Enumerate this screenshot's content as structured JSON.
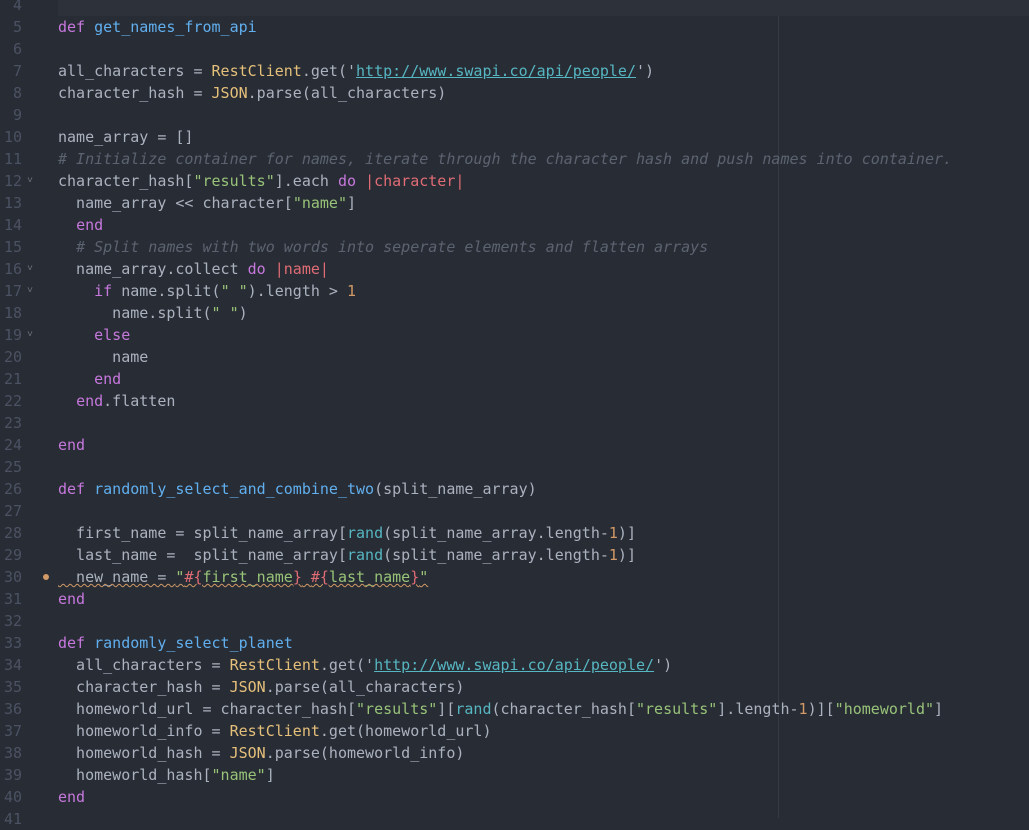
{
  "cursor_line": 4,
  "lines": [
    {
      "n": "4",
      "t": []
    },
    {
      "n": "5",
      "t": [
        [
          "k",
          "def"
        ],
        [
          "p",
          " "
        ],
        [
          "f",
          "get_names_from_api"
        ]
      ]
    },
    {
      "n": "6",
      "t": []
    },
    {
      "n": "7",
      "t": [
        [
          "p",
          "all_characters = "
        ],
        [
          "c",
          "RestClient"
        ],
        [
          "p",
          ".get('"
        ],
        [
          "u",
          "http://www.swapi.co/api/people/"
        ],
        [
          "p",
          "')"
        ]
      ]
    },
    {
      "n": "8",
      "t": [
        [
          "p",
          "character_hash = "
        ],
        [
          "c",
          "JSON"
        ],
        [
          "p",
          ".parse(all_characters)"
        ]
      ]
    },
    {
      "n": "9",
      "t": []
    },
    {
      "n": "10",
      "t": [
        [
          "p",
          "name_array = []"
        ]
      ]
    },
    {
      "n": "11",
      "t": [
        [
          "m",
          "# Initialize container for names, iterate through the character hash and push names into container."
        ]
      ]
    },
    {
      "n": "12",
      "fold": true,
      "t": [
        [
          "p",
          "character_hash["
        ],
        [
          "s",
          "\"results\""
        ],
        [
          "p",
          "].each "
        ],
        [
          "k",
          "do"
        ],
        [
          "p",
          " "
        ],
        [
          "r",
          "|character|"
        ]
      ]
    },
    {
      "n": "13",
      "t": [
        [
          "p",
          "  name_array << character["
        ],
        [
          "s",
          "\"name\""
        ],
        [
          "p",
          "]"
        ]
      ]
    },
    {
      "n": "14",
      "t": [
        [
          "p",
          "  "
        ],
        [
          "k",
          "end"
        ]
      ]
    },
    {
      "n": "15",
      "t": [
        [
          "p",
          "  "
        ],
        [
          "m",
          "# Split names with two words into seperate elements and flatten arrays"
        ]
      ]
    },
    {
      "n": "16",
      "fold": true,
      "t": [
        [
          "p",
          "  name_array.collect "
        ],
        [
          "k",
          "do"
        ],
        [
          "p",
          " "
        ],
        [
          "r",
          "|name|"
        ]
      ]
    },
    {
      "n": "17",
      "fold": true,
      "t": [
        [
          "p",
          "    "
        ],
        [
          "k",
          "if"
        ],
        [
          "p",
          " name.split("
        ],
        [
          "s",
          "\" \""
        ],
        [
          "p",
          ").length > "
        ],
        [
          "n",
          "1"
        ]
      ]
    },
    {
      "n": "18",
      "t": [
        [
          "p",
          "      name.split("
        ],
        [
          "s",
          "\" \""
        ],
        [
          "p",
          ")"
        ]
      ]
    },
    {
      "n": "19",
      "fold": true,
      "t": [
        [
          "p",
          "    "
        ],
        [
          "k",
          "else"
        ]
      ]
    },
    {
      "n": "20",
      "t": [
        [
          "p",
          "      name"
        ]
      ]
    },
    {
      "n": "21",
      "t": [
        [
          "p",
          "    "
        ],
        [
          "k",
          "end"
        ]
      ]
    },
    {
      "n": "22",
      "t": [
        [
          "p",
          "  "
        ],
        [
          "k",
          "end"
        ],
        [
          "p",
          ".flatten"
        ]
      ]
    },
    {
      "n": "23",
      "t": []
    },
    {
      "n": "24",
      "t": [
        [
          "k",
          "end"
        ]
      ]
    },
    {
      "n": "25",
      "t": []
    },
    {
      "n": "26",
      "t": [
        [
          "k",
          "def"
        ],
        [
          "p",
          " "
        ],
        [
          "f",
          "randomly_select_and_combine_two"
        ],
        [
          "p",
          "(split_name_array)"
        ]
      ]
    },
    {
      "n": "27",
      "t": []
    },
    {
      "n": "28",
      "t": [
        [
          "p",
          "  first_name = split_name_array["
        ],
        [
          "b",
          "rand"
        ],
        [
          "p",
          "(split_name_array.length-"
        ],
        [
          "n",
          "1"
        ],
        [
          "p",
          ")]"
        ]
      ]
    },
    {
      "n": "29",
      "t": [
        [
          "p",
          "  last_name =  split_name_array["
        ],
        [
          "b",
          "rand"
        ],
        [
          "p",
          "(split_name_array.length-"
        ],
        [
          "n",
          "1"
        ],
        [
          "p",
          ")]"
        ]
      ]
    },
    {
      "n": "30",
      "dot": true,
      "warn": true,
      "t": [
        [
          "p",
          "  new_name = "
        ],
        [
          "s",
          "\""
        ],
        [
          "r",
          "#{"
        ],
        [
          "s",
          "first_name"
        ],
        [
          "r",
          "}"
        ],
        [
          "s",
          " "
        ],
        [
          "r",
          "#{"
        ],
        [
          "s",
          "last_name"
        ],
        [
          "r",
          "}"
        ],
        [
          "s",
          "\""
        ]
      ]
    },
    {
      "n": "31",
      "t": [
        [
          "k",
          "end"
        ]
      ]
    },
    {
      "n": "32",
      "t": []
    },
    {
      "n": "33",
      "t": [
        [
          "k",
          "def"
        ],
        [
          "p",
          " "
        ],
        [
          "f",
          "randomly_select_planet"
        ]
      ]
    },
    {
      "n": "34",
      "t": [
        [
          "p",
          "  all_characters = "
        ],
        [
          "c",
          "RestClient"
        ],
        [
          "p",
          ".get('"
        ],
        [
          "u",
          "http://www.swapi.co/api/people/"
        ],
        [
          "p",
          "')"
        ]
      ]
    },
    {
      "n": "35",
      "t": [
        [
          "p",
          "  character_hash = "
        ],
        [
          "c",
          "JSON"
        ],
        [
          "p",
          ".parse(all_characters)"
        ]
      ]
    },
    {
      "n": "36",
      "t": [
        [
          "p",
          "  homeworld_url = character_hash["
        ],
        [
          "s",
          "\"results\""
        ],
        [
          "p",
          "]["
        ],
        [
          "b",
          "rand"
        ],
        [
          "p",
          "(character_hash["
        ],
        [
          "s",
          "\"results\""
        ],
        [
          "p",
          "].length-"
        ],
        [
          "n",
          "1"
        ],
        [
          "p",
          ")]["
        ],
        [
          "s",
          "\"homeworld\""
        ],
        [
          "p",
          "]"
        ]
      ]
    },
    {
      "n": "37",
      "t": [
        [
          "p",
          "  homeworld_info = "
        ],
        [
          "c",
          "RestClient"
        ],
        [
          "p",
          ".get(homeworld_url)"
        ]
      ]
    },
    {
      "n": "38",
      "t": [
        [
          "p",
          "  homeworld_hash = "
        ],
        [
          "c",
          "JSON"
        ],
        [
          "p",
          ".parse(homeworld_info)"
        ]
      ]
    },
    {
      "n": "39",
      "t": [
        [
          "p",
          "  homeworld_hash["
        ],
        [
          "s",
          "\"name\""
        ],
        [
          "p",
          "]"
        ]
      ]
    },
    {
      "n": "40",
      "t": [
        [
          "k",
          "end"
        ]
      ]
    },
    {
      "n": "41",
      "t": []
    }
  ]
}
